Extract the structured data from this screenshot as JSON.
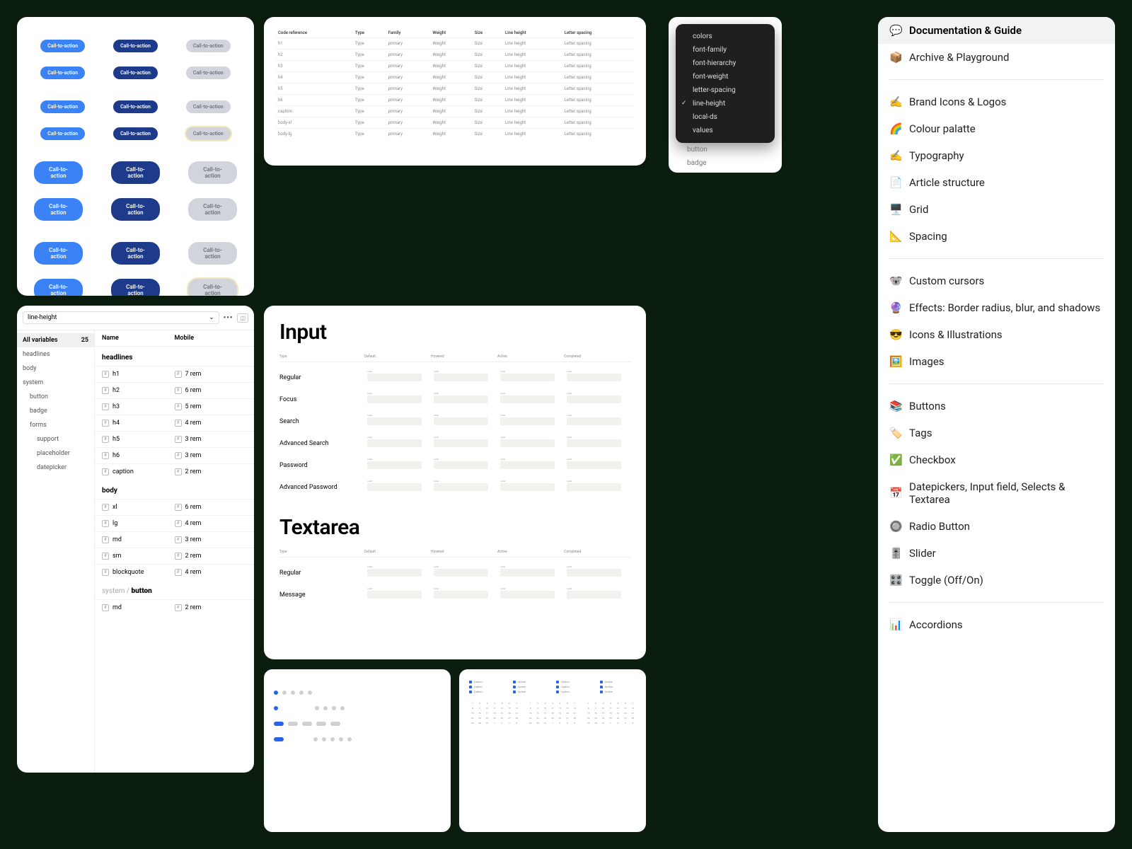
{
  "buttons": {
    "label": "Call-to-action"
  },
  "coderef": {
    "headers": [
      "Code reference",
      "Type",
      "Family",
      "Weight",
      "Size",
      "Line height",
      "Letter spacing"
    ],
    "rows": [
      [
        "h1",
        "Type",
        "primary",
        "Weight",
        "Size",
        "Line height",
        "Letter spacing"
      ],
      [
        "h2",
        "Type",
        "primary",
        "Weight",
        "Size",
        "Line height",
        "Letter spacing"
      ],
      [
        "h3",
        "Type",
        "primary",
        "Weight",
        "Size",
        "Line height",
        "Letter spacing"
      ],
      [
        "h4",
        "Type",
        "primary",
        "Weight",
        "Size",
        "Line height",
        "Letter spacing"
      ],
      [
        "h5",
        "Type",
        "primary",
        "Weight",
        "Size",
        "Line height",
        "Letter spacing"
      ],
      [
        "h6",
        "Type",
        "primary",
        "Weight",
        "Size",
        "Line height",
        "Letter spacing"
      ],
      [
        "caption",
        "Type",
        "primary",
        "Weight",
        "Size",
        "Line height",
        "Letter spacing"
      ],
      [
        "body-xl",
        "Type",
        "primary",
        "Weight",
        "Size",
        "Line height",
        "Letter spacing"
      ],
      [
        "body-lg",
        "Type",
        "primary",
        "Weight",
        "Size",
        "Line height",
        "Letter spacing"
      ]
    ]
  },
  "ctx": {
    "items": [
      "colors",
      "font-family",
      "font-hierarchy",
      "font-weight",
      "letter-spacing",
      "line-height",
      "local-ds",
      "values"
    ],
    "selected": "line-height",
    "below": [
      "button",
      "badge"
    ]
  },
  "sidebar": {
    "header": {
      "icon": "💬",
      "label": "Documentation & Guide"
    },
    "groups": [
      [
        {
          "icon": "📦",
          "label": "Archive & Playground"
        }
      ],
      [
        {
          "icon": "✍️",
          "label": "Brand Icons & Logos"
        },
        {
          "icon": "🌈",
          "label": "Colour palatte"
        },
        {
          "icon": "✍️",
          "label": "Typography"
        },
        {
          "icon": "📄",
          "label": "Article structure"
        },
        {
          "icon": "🖥️",
          "label": "Grid"
        },
        {
          "icon": "📐",
          "label": "Spacing"
        }
      ],
      [
        {
          "icon": "🐨",
          "label": "Custom cursors"
        },
        {
          "icon": "🔮",
          "label": "Effects: Border radius, blur, and shadows"
        },
        {
          "icon": "😎",
          "label": "Icons & Illustrations"
        },
        {
          "icon": "🖼️",
          "label": "Images"
        }
      ],
      [
        {
          "icon": "📚",
          "label": "Buttons"
        },
        {
          "icon": "🏷️",
          "label": "Tags"
        },
        {
          "icon": "✅",
          "label": "Checkbox"
        },
        {
          "icon": "📅",
          "label": "Datepickers, Input field, Selects & Textarea"
        },
        {
          "icon": "🔘",
          "label": "Radio Button"
        },
        {
          "icon": "🎚️",
          "label": "Slider"
        },
        {
          "icon": "🎛️",
          "label": "Toggle (Off/On)"
        }
      ],
      [
        {
          "icon": "📊",
          "label": "Accordions"
        }
      ]
    ]
  },
  "vars": {
    "selector": "line-height",
    "all_vars": "All variables",
    "count": "25",
    "col1": "Name",
    "col2": "Mobile",
    "tree": [
      "headlines",
      "body",
      "system"
    ],
    "tree_system": [
      "button",
      "badge",
      "forms"
    ],
    "tree_forms": [
      "support",
      "placeholder",
      "datepicker"
    ],
    "sections": [
      {
        "name": "headlines",
        "rows": [
          {
            "n": "h1",
            "v": "7 rem"
          },
          {
            "n": "h2",
            "v": "6 rem"
          },
          {
            "n": "h3",
            "v": "5 rem"
          },
          {
            "n": "h4",
            "v": "4 rem"
          },
          {
            "n": "h5",
            "v": "3 rem"
          },
          {
            "n": "h6",
            "v": "3 rem"
          },
          {
            "n": "caption",
            "v": "2 rem"
          }
        ]
      },
      {
        "name": "body",
        "rows": [
          {
            "n": "xl",
            "v": "6 rem"
          },
          {
            "n": "lg",
            "v": "4 rem"
          },
          {
            "n": "md",
            "v": "3 rem"
          },
          {
            "n": "sm",
            "v": "2 rem"
          },
          {
            "n": "blockquote",
            "v": "4 rem"
          }
        ]
      },
      {
        "name": "system / button",
        "prefix": "system / ",
        "rows": [
          {
            "n": "md",
            "v": "2 rem"
          }
        ]
      }
    ]
  },
  "inputspec": {
    "title1": "Input",
    "title2": "Textarea",
    "columns": [
      "Type",
      "Default",
      "Hovered",
      "Active",
      "Completed"
    ],
    "rows1": [
      "Regular",
      "Focus",
      "Search",
      "Advanced Search",
      "Password",
      "Advanced Password"
    ],
    "rows2": [
      "Regular",
      "Message"
    ]
  }
}
